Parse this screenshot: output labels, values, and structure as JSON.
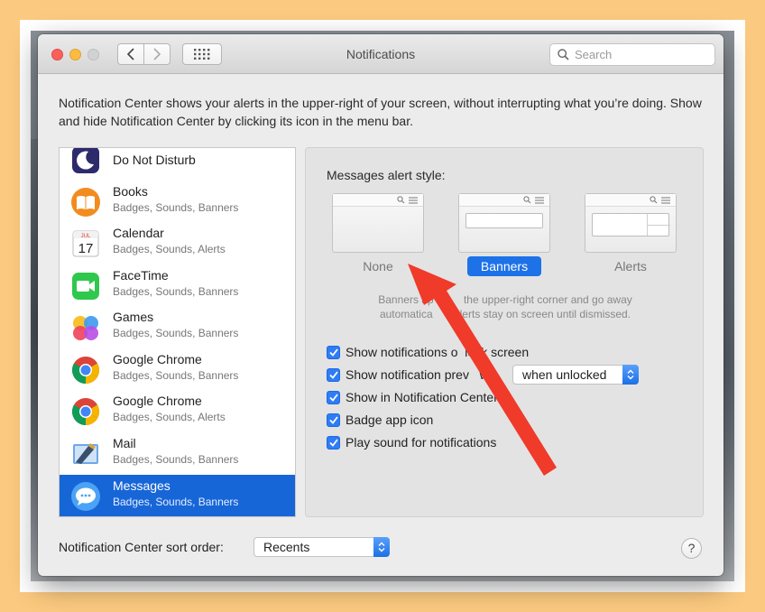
{
  "window": {
    "title": "Notifications",
    "search_placeholder": "Search"
  },
  "description": "Notification Center shows your alerts in the upper-right of your screen, without interrupting what you’re doing. Show and hide Notification Center by clicking its icon in the menu bar.",
  "apps": [
    {
      "name": "Do Not Disturb",
      "subtitle": "",
      "icon": "moon-icon"
    },
    {
      "name": "Books",
      "subtitle": "Badges, Sounds, Banners",
      "icon": "books-icon"
    },
    {
      "name": "Calendar",
      "subtitle": "Badges, Sounds, Alerts",
      "icon": "calendar-icon",
      "calendar_month": "JUL",
      "calendar_day": "17"
    },
    {
      "name": "FaceTime",
      "subtitle": "Badges, Sounds, Banners",
      "icon": "facetime-icon"
    },
    {
      "name": "Games",
      "subtitle": "Badges, Sounds, Banners",
      "icon": "games-icon"
    },
    {
      "name": "Google Chrome",
      "subtitle": "Badges, Sounds, Banners",
      "icon": "chrome-icon"
    },
    {
      "name": "Google Chrome",
      "subtitle": "Badges, Sounds, Alerts",
      "icon": "chrome-icon"
    },
    {
      "name": "Mail",
      "subtitle": "Badges, Sounds, Banners",
      "icon": "mail-icon"
    },
    {
      "name": "Messages",
      "subtitle": "Badges, Sounds, Banners",
      "icon": "messages-icon",
      "selected": true
    }
  ],
  "alert_panel": {
    "title": "Messages alert style:",
    "styles": [
      "None",
      "Banners",
      "Alerts"
    ],
    "selected_style": "Banners",
    "hint_line1": "Banners ap          the upper-right corner and go away",
    "hint_line2": "automatica         lerts stay on screen until dismissed.",
    "options": [
      {
        "label": "Show notifications o  lock screen",
        "checked": true
      },
      {
        "label": "Show notification prev   w",
        "checked": true
      },
      {
        "label": "Show in Notification Center",
        "checked": true
      },
      {
        "label": "Badge app icon",
        "checked": true
      },
      {
        "label": "Play sound for notifications",
        "checked": true
      }
    ],
    "preview_value": "when unlocked"
  },
  "footer": {
    "sort_label": "Notification Center sort order:",
    "sort_value": "Recents",
    "help_label": "?"
  },
  "colors": {
    "accent": "#1766d8",
    "annotation_arrow": "#f03a2a",
    "background_border": "#fbc97f"
  }
}
